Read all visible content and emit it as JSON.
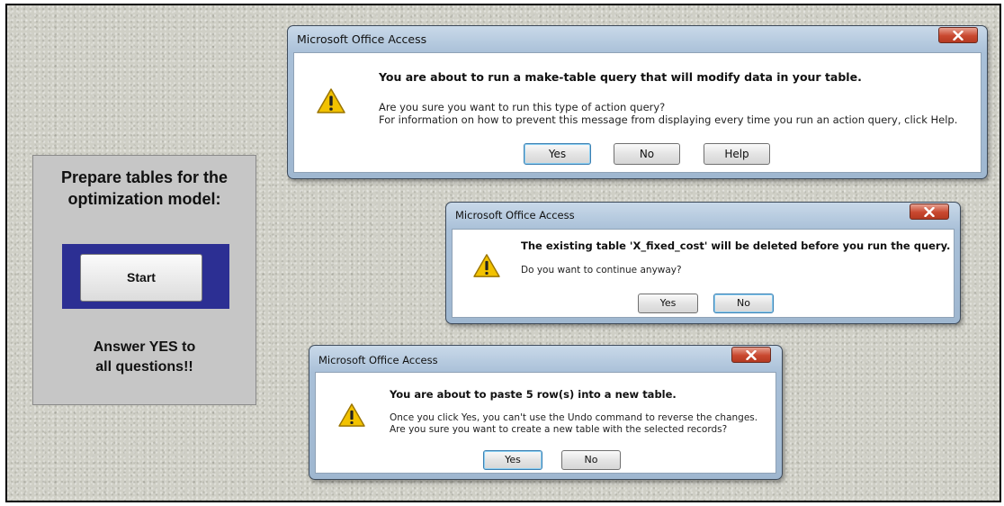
{
  "panel": {
    "title": "Prepare tables for the\noptimization model:",
    "start_label": "Start",
    "note": "Answer YES to\nall questions!!"
  },
  "dialog1": {
    "title": "Microsoft Office Access",
    "heading": "You are about to run a make-table query that will modify data in your table.",
    "line1": "Are you sure you want to run this type of action query?",
    "line2": "For information on how to prevent this message from displaying every time you run an action query, click Help.",
    "yes": "Yes",
    "no": "No",
    "help": "Help"
  },
  "dialog2": {
    "title": "Microsoft Office Access",
    "heading": "The existing table 'X_fixed_cost' will be deleted before you run the query.",
    "line1": "Do you want to continue anyway?",
    "yes": "Yes",
    "no": "No"
  },
  "dialog3": {
    "title": "Microsoft Office Access",
    "heading": "You are about to paste 5 row(s) into a new table.",
    "line1": "Once you click Yes, you can't use the Undo command to reverse the changes.",
    "line2": "Are you sure you want to create a new table with the selected records?",
    "yes": "Yes",
    "no": "No"
  },
  "colors": {
    "start_frame": "#2c2f93",
    "close_button": "#c9482f",
    "warning": "#f2c200"
  },
  "icons": [
    "warning-icon",
    "close-icon"
  ]
}
